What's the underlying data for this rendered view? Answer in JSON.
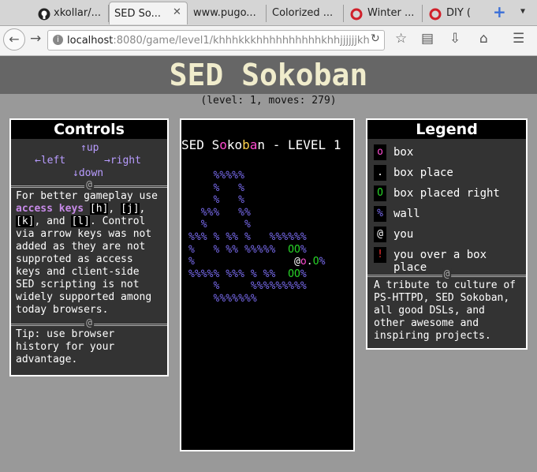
{
  "browser": {
    "tabs": [
      {
        "label": "xkollar/...",
        "favicon": "github-icon"
      },
      {
        "label": "SED So...",
        "favicon": "page-icon",
        "active": true
      },
      {
        "label": "www.pugo...",
        "favicon": "none"
      },
      {
        "label": "Colorized ...",
        "favicon": "none"
      },
      {
        "label": "Winter ...",
        "favicon": "redhat-icon"
      },
      {
        "label": "DIY (",
        "favicon": "redhat-icon"
      }
    ],
    "url_host": "localhost",
    "url_path": ":8080/game/level1/khhhkkkhhhhhhhhhhkhhjjjjjjkh"
  },
  "page": {
    "title": "SED Sokoban",
    "status": "(level: 1, moves: 279)"
  },
  "controls": {
    "title": "Controls",
    "up": "↑up",
    "left": "←left",
    "right": "→right",
    "down": "↓down",
    "divider": "@",
    "text_before": "For better gameplay use",
    "access_keys": "access keys",
    "key_h": "[h]",
    "key_j": "[j]",
    "key_k": "[k]",
    "key_l": "[l]",
    "text_and": ", and",
    "text_after": ". Control via arrow keys was not added as they are not supproted as access keys and client-side SED scripting is not widely supported among today browsers.",
    "tip": "Tip: use browser history for your advantage."
  },
  "game": {
    "title": "SED Sokoban - LEVEL 1"
  },
  "legend": {
    "title": "Legend",
    "items": [
      {
        "symbol": "o",
        "label": "box",
        "color": "#ff4cd2"
      },
      {
        "symbol": ".",
        "label": "box place",
        "color": "#ffffff"
      },
      {
        "symbol": "O",
        "label": "box placed right",
        "color": "#28d428"
      },
      {
        "symbol": "%",
        "label": "wall",
        "color": "#7a6cf0"
      },
      {
        "symbol": "@",
        "label": "you",
        "color": "#ffffff"
      },
      {
        "symbol": "!",
        "label": "you over a box place",
        "color": "#ff3030"
      }
    ],
    "divider": "@",
    "tribute": "A tribute to culture of PS-HTTPD, SED Sokoban, all good DSLs, and other awesome and inspiring projects."
  },
  "colors": {
    "wall": "#7a6cf0",
    "box": "#ff4cd2",
    "placed": "#28d428",
    "header_bg": "#666666",
    "title": "#f0eccc"
  }
}
